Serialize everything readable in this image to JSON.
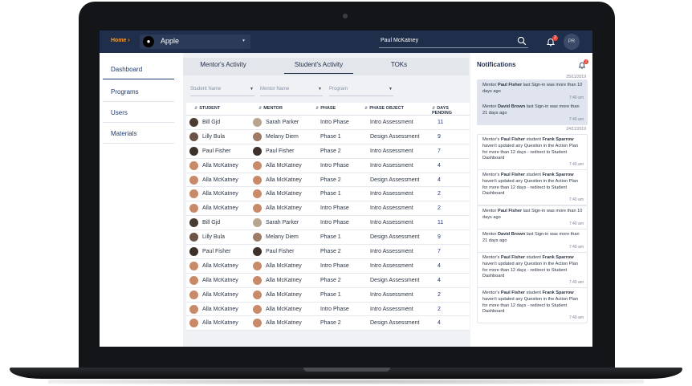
{
  "topbar": {
    "home_label": "Home ›",
    "app_name": "Apple",
    "search_value": "Paul McKatney",
    "bell_count": "2",
    "user_initials": "PR"
  },
  "sidebar": {
    "items": [
      {
        "label": "Dashboard"
      },
      {
        "label": "Programs"
      },
      {
        "label": "Users"
      },
      {
        "label": "Materials"
      }
    ]
  },
  "tabs": [
    {
      "label": "Mentor's Activity"
    },
    {
      "label": "Student's Activity"
    },
    {
      "label": "TOKs"
    }
  ],
  "filters": [
    {
      "placeholder": "Student Name"
    },
    {
      "placeholder": "Mentor Name"
    },
    {
      "placeholder": "Program"
    }
  ],
  "table": {
    "headers": [
      "STUDENT",
      "MENTOR",
      "PHASE",
      "PHASE OBJECT",
      "DAYS PENDING"
    ],
    "rows": [
      {
        "student": "Bill Gjd",
        "mentor": "Sarah Parker",
        "phase": "Intro Phase",
        "object": "Intro Assessment",
        "days": "11"
      },
      {
        "student": "Lilly Bula",
        "mentor": "Melany Diem",
        "phase": "Phase 1",
        "object": "Design Assessment",
        "days": "9"
      },
      {
        "student": "Paul Fisher",
        "mentor": "Paul Fisher",
        "phase": "Phase 2",
        "object": "Intro Assessment",
        "days": "7"
      },
      {
        "student": "Alla McKatney",
        "mentor": "Alla McKatney",
        "phase": "Intro Phase",
        "object": "Intro Assessment",
        "days": "4"
      },
      {
        "student": "Alla McKatney",
        "mentor": "Alla McKatney",
        "phase": "Phase 2",
        "object": "Design Assessment",
        "days": "4"
      },
      {
        "student": "Alla McKatney",
        "mentor": "Alla McKatney",
        "phase": "Phase 1",
        "object": "Intro Assessment",
        "days": "2"
      },
      {
        "student": "Alla McKatney",
        "mentor": "Alla McKatney",
        "phase": "Intro Phase",
        "object": "Intro Assessment",
        "days": "2"
      },
      {
        "student": "Bill Gjd",
        "mentor": "Sarah Parker",
        "phase": "Intro Phase",
        "object": "Intro Assessment",
        "days": "11"
      },
      {
        "student": "Lilly Bula",
        "mentor": "Melany Diem",
        "phase": "Phase 1",
        "object": "Design Assessment",
        "days": "9"
      },
      {
        "student": "Paul Fisher",
        "mentor": "Paul Fisher",
        "phase": "Phase 2",
        "object": "Intro Assessment",
        "days": "7"
      },
      {
        "student": "Alla McKatney",
        "mentor": "Alla McKatney",
        "phase": "Intro Phase",
        "object": "Intro Assessment",
        "days": "4"
      },
      {
        "student": "Alla McKatney",
        "mentor": "Alla McKatney",
        "phase": "Phase 2",
        "object": "Design Assessment",
        "days": "4"
      },
      {
        "student": "Alla McKatney",
        "mentor": "Alla McKatney",
        "phase": "Phase 1",
        "object": "Intro Assessment",
        "days": "2"
      },
      {
        "student": "Alla McKatney",
        "mentor": "Alla McKatney",
        "phase": "Intro Phase",
        "object": "Intro Assessment",
        "days": "2"
      },
      {
        "student": "Alla McKatney",
        "mentor": "Alla McKatney",
        "phase": "Phase 2",
        "object": "Design Assessment",
        "days": "4"
      }
    ]
  },
  "notifications": {
    "title": "Notifications",
    "badge": "2",
    "dates": [
      "25/11/2019",
      "24/11/2019"
    ],
    "items": [
      {
        "pre": "Mentor ",
        "name": "Paul Fisher",
        "mid": " last Sign-in was more than 10 days ago",
        "name2": "",
        "post": "",
        "time": "7:40 am"
      },
      {
        "pre": "Mentor ",
        "name": "David Brown",
        "mid": " last Sign-in was more than 21 days ago",
        "name2": "",
        "post": "",
        "time": "7:40 am"
      },
      {
        "pre": "Mentor's ",
        "name": "Paul Fisher",
        "mid": " student ",
        "name2": "Frank Sparrow",
        "post": " haven't updated any Question in the Action Plan for more than 12 days - redirect to Student Dashboard",
        "time": "7:40 am"
      },
      {
        "pre": "Mentor's ",
        "name": "Paul Fisher",
        "mid": " student ",
        "name2": "Frank Sparrow",
        "post": " haven't updated any Question in the Action Plan for more than 12 days - redirect to Student Dashboard",
        "time": "7:40 am"
      },
      {
        "pre": "Mentor ",
        "name": "Paul Fisher",
        "mid": " last Sign-in was more than 10 days ago",
        "name2": "",
        "post": "",
        "time": "7:40 am"
      },
      {
        "pre": "Mentor ",
        "name": "David Brown",
        "mid": " last Sign-in was more than 21 days ago",
        "name2": "",
        "post": "",
        "time": "7:40 am"
      },
      {
        "pre": "Mentor's ",
        "name": "Paul Fisher",
        "mid": " student ",
        "name2": "Frank Sparrow",
        "post": " haven't updated any Question in the Action Plan for more than 12 days - redirect to Student Dashboard",
        "time": "7:40 am"
      },
      {
        "pre": "Mentor's ",
        "name": "Paul Fisher",
        "mid": " student ",
        "name2": "Frank Sparrow",
        "post": " haven't updated any Question in the Action Plan for more than 12 days - redirect to Student Dashboard",
        "time": "7:40 am"
      }
    ]
  },
  "colors": {
    "navy": "#1f2e4a",
    "accent_orange": "#f39c3a",
    "badge_red": "#e8453c",
    "days_blue": "#1f3a8a"
  }
}
